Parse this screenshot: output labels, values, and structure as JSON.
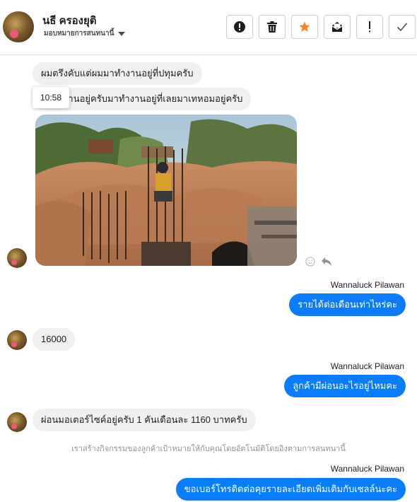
{
  "header": {
    "contact_name": "นธี ครองยุติ",
    "assignment_label": "มอบหมายการสนทนานี้",
    "actions": [
      {
        "name": "report-spam-button",
        "icon": "alert-circle-icon"
      },
      {
        "name": "delete-button",
        "icon": "trash-icon"
      },
      {
        "name": "star-button",
        "icon": "star-icon"
      },
      {
        "name": "mark-unread-button",
        "icon": "envelope-icon"
      },
      {
        "name": "follow-up-button",
        "icon": "exclamation-icon"
      },
      {
        "name": "mark-done-button",
        "icon": "check-icon"
      }
    ]
  },
  "colors": {
    "outgoing_bubble": "#0a7cff",
    "incoming_bubble": "#f0f0f0",
    "star_active": "#f5872b"
  },
  "thread": {
    "messages": [
      {
        "direction": "in",
        "text": "ผมตรึงคับแต่ผมมาทำงานอยู่ที่ปทุมครับ"
      },
      {
        "direction": "in",
        "text": "ผมทำงานอยู่ครับมาทำงานอยู่ที่เลยมาเทหอมอยู่ครับ"
      },
      {
        "direction": "in",
        "type": "image"
      },
      {
        "direction": "out",
        "sender": "Wannaluck Pilawan",
        "text": "รายได้ต่อเดือนเท่าไหร่คะ"
      },
      {
        "direction": "in",
        "text": "16000"
      },
      {
        "direction": "out",
        "sender": "Wannaluck Pilawan",
        "text": "ลูกค้ามีผ่อนอะไรอยู่ไหมคะ"
      },
      {
        "direction": "in",
        "text": "ผ่อนมอเตอร์ไซค์อยู่ครับ 1 คันเดือนละ 1160 บาทครับ"
      },
      {
        "direction": "out",
        "sender": "Wannaluck Pilawan",
        "text": "ขอเบอร์โทรติดต่อคุยรายละเอียดเพิ่มเติมกับเซลล์นะคะ"
      }
    ],
    "tooltip_time": "10:58",
    "system_note": "เราสร้างกิจกรรมของลูกค้าเป้าหมายให้กับคุณโดยอัตโนมัติโดยอิงตามการสนทนานี้"
  }
}
